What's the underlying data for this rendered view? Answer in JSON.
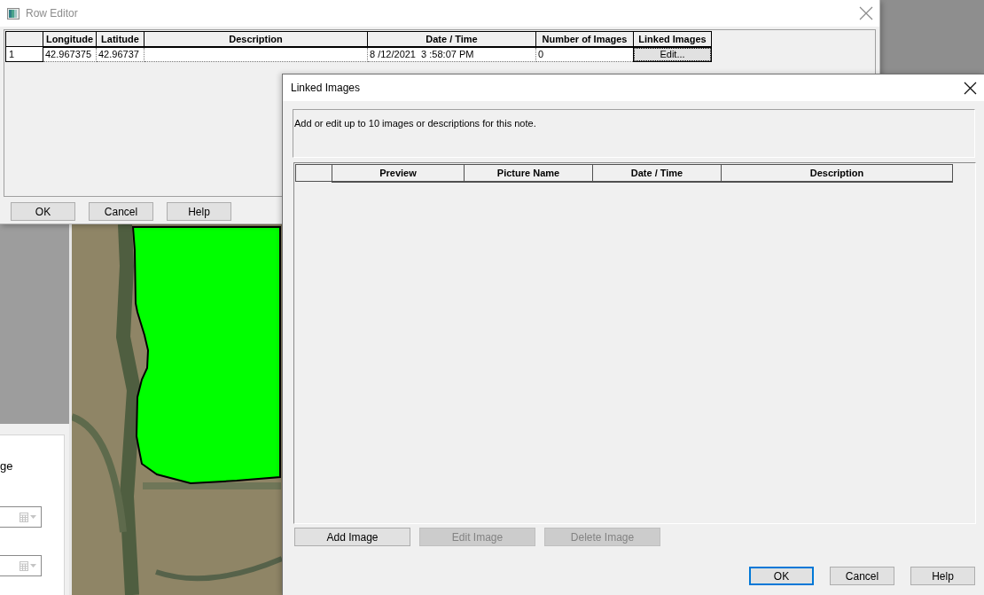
{
  "background_app": {
    "form_panel": {
      "label": "ge",
      "date_fields": [
        {
          "disabled": true
        },
        {
          "disabled": true
        }
      ]
    }
  },
  "row_editor": {
    "title": "Row Editor",
    "active": false,
    "table": {
      "columns": [
        "Longitude",
        "Latitude",
        "Description",
        "Date / Time",
        "Number of Images",
        "Linked Images"
      ],
      "rows": [
        {
          "row_header": "1",
          "longitude": "42.967375",
          "latitude": "42.96737",
          "date_time": "8 /12/2021  3 :58:07 PM",
          "number_of_images": "0",
          "linked_images_button": "Edit..."
        }
      ]
    },
    "buttons": [
      "OK",
      "Cancel",
      "Help"
    ]
  },
  "linked_images_dialog": {
    "title": "Linked Images",
    "active": true,
    "instructions": "Add or edit up to 10 images or descriptions for this note.",
    "table": {
      "columns": [
        "Preview",
        "Picture Name",
        "Date / Time",
        "Description"
      ]
    },
    "image_buttons": [
      {
        "label": "Add Image",
        "disabled": false
      },
      {
        "label": "Edit Image",
        "disabled": true
      },
      {
        "label": "Delete Image",
        "disabled": true
      }
    ],
    "dialog_buttons": [
      {
        "label": "OK",
        "focused": true
      },
      {
        "label": "Cancel",
        "focused": false
      },
      {
        "label": "Help",
        "focused": false
      }
    ]
  }
}
